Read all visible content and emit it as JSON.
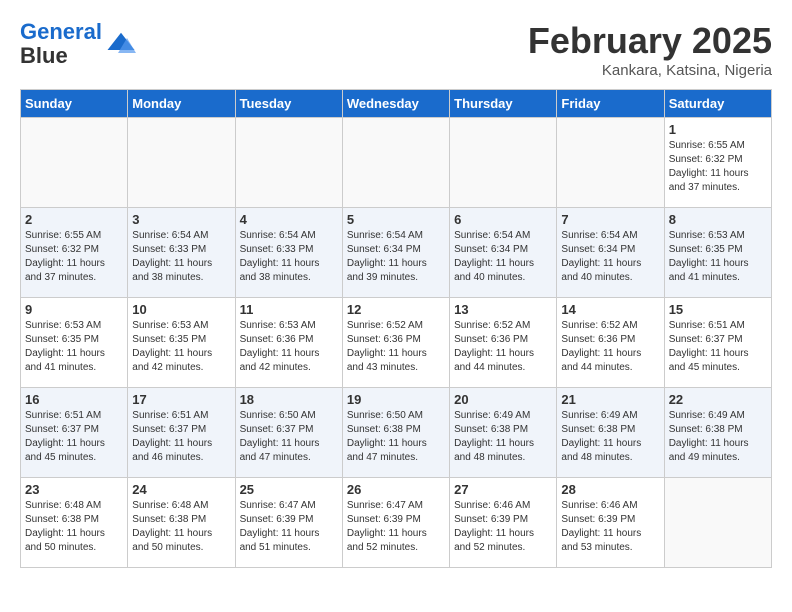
{
  "header": {
    "logo_line1": "General",
    "logo_line2": "Blue",
    "month": "February 2025",
    "location": "Kankara, Katsina, Nigeria"
  },
  "weekdays": [
    "Sunday",
    "Monday",
    "Tuesday",
    "Wednesday",
    "Thursday",
    "Friday",
    "Saturday"
  ],
  "weeks": [
    [
      {
        "day": "",
        "info": ""
      },
      {
        "day": "",
        "info": ""
      },
      {
        "day": "",
        "info": ""
      },
      {
        "day": "",
        "info": ""
      },
      {
        "day": "",
        "info": ""
      },
      {
        "day": "",
        "info": ""
      },
      {
        "day": "1",
        "info": "Sunrise: 6:55 AM\nSunset: 6:32 PM\nDaylight: 11 hours\nand 37 minutes."
      }
    ],
    [
      {
        "day": "2",
        "info": "Sunrise: 6:55 AM\nSunset: 6:32 PM\nDaylight: 11 hours\nand 37 minutes."
      },
      {
        "day": "3",
        "info": "Sunrise: 6:54 AM\nSunset: 6:33 PM\nDaylight: 11 hours\nand 38 minutes."
      },
      {
        "day": "4",
        "info": "Sunrise: 6:54 AM\nSunset: 6:33 PM\nDaylight: 11 hours\nand 38 minutes."
      },
      {
        "day": "5",
        "info": "Sunrise: 6:54 AM\nSunset: 6:34 PM\nDaylight: 11 hours\nand 39 minutes."
      },
      {
        "day": "6",
        "info": "Sunrise: 6:54 AM\nSunset: 6:34 PM\nDaylight: 11 hours\nand 40 minutes."
      },
      {
        "day": "7",
        "info": "Sunrise: 6:54 AM\nSunset: 6:34 PM\nDaylight: 11 hours\nand 40 minutes."
      },
      {
        "day": "8",
        "info": "Sunrise: 6:53 AM\nSunset: 6:35 PM\nDaylight: 11 hours\nand 41 minutes."
      }
    ],
    [
      {
        "day": "9",
        "info": "Sunrise: 6:53 AM\nSunset: 6:35 PM\nDaylight: 11 hours\nand 41 minutes."
      },
      {
        "day": "10",
        "info": "Sunrise: 6:53 AM\nSunset: 6:35 PM\nDaylight: 11 hours\nand 42 minutes."
      },
      {
        "day": "11",
        "info": "Sunrise: 6:53 AM\nSunset: 6:36 PM\nDaylight: 11 hours\nand 42 minutes."
      },
      {
        "day": "12",
        "info": "Sunrise: 6:52 AM\nSunset: 6:36 PM\nDaylight: 11 hours\nand 43 minutes."
      },
      {
        "day": "13",
        "info": "Sunrise: 6:52 AM\nSunset: 6:36 PM\nDaylight: 11 hours\nand 44 minutes."
      },
      {
        "day": "14",
        "info": "Sunrise: 6:52 AM\nSunset: 6:36 PM\nDaylight: 11 hours\nand 44 minutes."
      },
      {
        "day": "15",
        "info": "Sunrise: 6:51 AM\nSunset: 6:37 PM\nDaylight: 11 hours\nand 45 minutes."
      }
    ],
    [
      {
        "day": "16",
        "info": "Sunrise: 6:51 AM\nSunset: 6:37 PM\nDaylight: 11 hours\nand 45 minutes."
      },
      {
        "day": "17",
        "info": "Sunrise: 6:51 AM\nSunset: 6:37 PM\nDaylight: 11 hours\nand 46 minutes."
      },
      {
        "day": "18",
        "info": "Sunrise: 6:50 AM\nSunset: 6:37 PM\nDaylight: 11 hours\nand 47 minutes."
      },
      {
        "day": "19",
        "info": "Sunrise: 6:50 AM\nSunset: 6:38 PM\nDaylight: 11 hours\nand 47 minutes."
      },
      {
        "day": "20",
        "info": "Sunrise: 6:49 AM\nSunset: 6:38 PM\nDaylight: 11 hours\nand 48 minutes."
      },
      {
        "day": "21",
        "info": "Sunrise: 6:49 AM\nSunset: 6:38 PM\nDaylight: 11 hours\nand 48 minutes."
      },
      {
        "day": "22",
        "info": "Sunrise: 6:49 AM\nSunset: 6:38 PM\nDaylight: 11 hours\nand 49 minutes."
      }
    ],
    [
      {
        "day": "23",
        "info": "Sunrise: 6:48 AM\nSunset: 6:38 PM\nDaylight: 11 hours\nand 50 minutes."
      },
      {
        "day": "24",
        "info": "Sunrise: 6:48 AM\nSunset: 6:38 PM\nDaylight: 11 hours\nand 50 minutes."
      },
      {
        "day": "25",
        "info": "Sunrise: 6:47 AM\nSunset: 6:39 PM\nDaylight: 11 hours\nand 51 minutes."
      },
      {
        "day": "26",
        "info": "Sunrise: 6:47 AM\nSunset: 6:39 PM\nDaylight: 11 hours\nand 52 minutes."
      },
      {
        "day": "27",
        "info": "Sunrise: 6:46 AM\nSunset: 6:39 PM\nDaylight: 11 hours\nand 52 minutes."
      },
      {
        "day": "28",
        "info": "Sunrise: 6:46 AM\nSunset: 6:39 PM\nDaylight: 11 hours\nand 53 minutes."
      },
      {
        "day": "",
        "info": ""
      }
    ]
  ]
}
